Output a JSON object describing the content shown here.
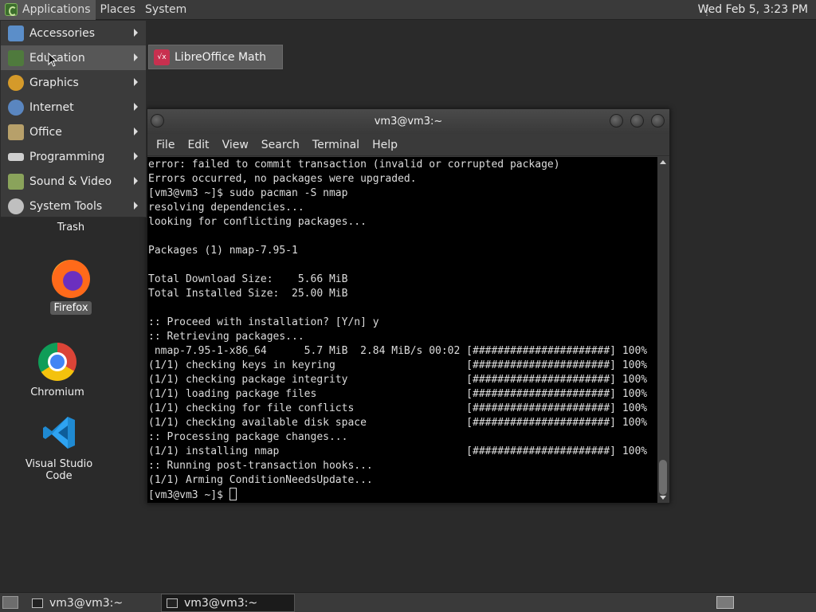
{
  "top_panel": {
    "menus": [
      "Applications",
      "Places",
      "System"
    ],
    "clock": "Wed Feb  5,  3:23 PM"
  },
  "app_menu": {
    "items": [
      {
        "label": "Accessories",
        "icon": "accessories-icon"
      },
      {
        "label": "Education",
        "icon": "education-icon"
      },
      {
        "label": "Graphics",
        "icon": "graphics-icon"
      },
      {
        "label": "Internet",
        "icon": "internet-icon"
      },
      {
        "label": "Office",
        "icon": "office-icon"
      },
      {
        "label": "Programming",
        "icon": "programming-icon"
      },
      {
        "label": "Sound & Video",
        "icon": "sound-video-icon"
      },
      {
        "label": "System Tools",
        "icon": "system-tools-icon"
      }
    ],
    "submenu": {
      "label": "LibreOffice Math",
      "icon": "libreoffice-math-icon"
    }
  },
  "desktop": {
    "trash": "Trash",
    "firefox": "Firefox",
    "chromium": "Chromium",
    "vscode": "Visual Studio Code"
  },
  "terminal": {
    "title": "vm3@vm3:~",
    "menu": [
      "File",
      "Edit",
      "View",
      "Search",
      "Terminal",
      "Help"
    ],
    "lines": [
      "error: failed to commit transaction (invalid or corrupted package)",
      "Errors occurred, no packages were upgraded.",
      "[vm3@vm3 ~]$ sudo pacman -S nmap",
      "resolving dependencies...",
      "looking for conflicting packages...",
      "",
      "Packages (1) nmap-7.95-1",
      "",
      "Total Download Size:    5.66 MiB",
      "Total Installed Size:  25.00 MiB",
      "",
      ":: Proceed with installation? [Y/n] y",
      ":: Retrieving packages...",
      " nmap-7.95-1-x86_64      5.7 MiB  2.84 MiB/s 00:02 [######################] 100%",
      "(1/1) checking keys in keyring                     [######################] 100%",
      "(1/1) checking package integrity                   [######################] 100%",
      "(1/1) loading package files                        [######################] 100%",
      "(1/1) checking for file conflicts                  [######################] 100%",
      "(1/1) checking available disk space                [######################] 100%",
      ":: Processing package changes...",
      "(1/1) installing nmap                              [######################] 100%",
      ":: Running post-transaction hooks...",
      "(1/1) Arming ConditionNeedsUpdate...",
      "[vm3@vm3 ~]$ "
    ]
  },
  "taskbar": {
    "tasks": [
      "vm3@vm3:~",
      "vm3@vm3:~"
    ]
  },
  "colors": {
    "panel": "#3a3a3a",
    "desktop": "#2a2a2a",
    "terminal_bg": "#000000",
    "terminal_fg": "#dcdcdc",
    "menu_hover": "#575757"
  }
}
